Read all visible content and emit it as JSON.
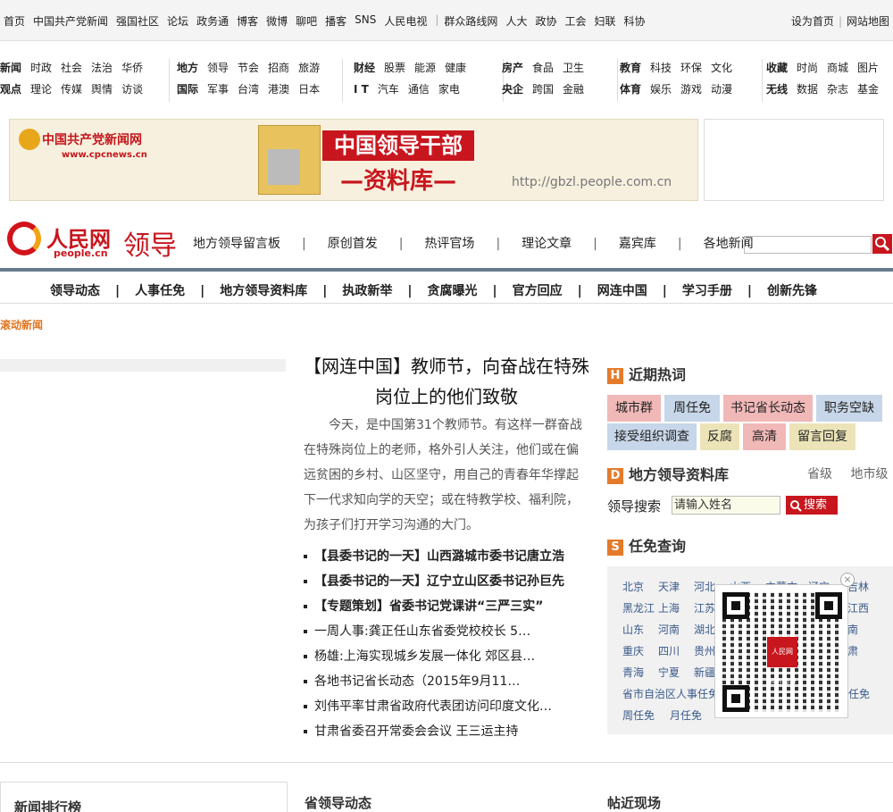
{
  "topbar": {
    "links": [
      "首页",
      "中国共产党新闻",
      "强国社区",
      "论坛",
      "政务通",
      "博客",
      "微博",
      "聊吧",
      "播客",
      "SNS",
      "人民电视",
      "|",
      "群众路线网",
      "人大",
      "政协",
      "工会",
      "妇联",
      "科协"
    ],
    "right_home": "设为首页",
    "right_sep": "|",
    "right_map": "网站地图"
  },
  "channels": [
    {
      "rows": [
        [
          "新闻",
          "时政",
          "社会",
          "法治",
          "华侨"
        ],
        [
          "观点",
          "理论",
          "传媒",
          "舆情",
          "访谈"
        ]
      ]
    },
    {
      "rows": [
        [
          "地方",
          "领导",
          "节会",
          "招商",
          "旅游"
        ],
        [
          "国际",
          "军事",
          "台湾",
          "港澳",
          "日本"
        ]
      ]
    },
    {
      "rows": [
        [
          "财经",
          "股票",
          "能源",
          "健康"
        ],
        [
          "I T",
          "汽车",
          "通信",
          "家电"
        ]
      ]
    },
    {
      "rows": [
        [
          "房产",
          "食品",
          "卫生"
        ],
        [
          "央企",
          "跨国",
          "金融"
        ]
      ]
    },
    {
      "rows": [
        [
          "教育",
          "科技",
          "环保",
          "文化"
        ],
        [
          "体育",
          "娱乐",
          "游戏",
          "动漫"
        ]
      ]
    },
    {
      "rows": [
        [
          "收藏",
          "时尚",
          "商城",
          "图片"
        ],
        [
          "无线",
          "数据",
          "杂志",
          "基金"
        ]
      ]
    }
  ],
  "banner": {
    "party_name": "中国共产党新闻网",
    "party_url": "www.cpcnews.cn",
    "title1": "中国领导干部",
    "title2": "—资料库—",
    "url": "http://gbzl.people.com.cn"
  },
  "logo": {
    "cn": "人民网",
    "en": "people.cn"
  },
  "section_title": "领导",
  "subnav": [
    "地方领导留言板",
    "原创首发",
    "热评官场",
    "理论文章",
    "嘉宾库",
    "各地新闻"
  ],
  "mainnav": [
    "领导动态",
    "人事任免",
    "地方领导资料库",
    "执政新举",
    "贪腐曝光",
    "官方回应",
    "网连中国",
    "学习手册",
    "创新先锋"
  ],
  "nav_sep": "|",
  "rolling_news": "滚动新闻",
  "article": {
    "headline": "【网连中国】教师节，向奋战在特殊岗位上的他们致敬",
    "lead": "今天，是中国第31个教师节。有这样一群奋战在特殊岗位上的老师，格外引人关注，他们或在偏远贫困的乡村、山区坚守，用自己的青春年华撑起下一代求知向学的天空；或在特教学校、福利院，为孩子们打开学习沟通的大门。"
  },
  "news": [
    {
      "text": "【县委书记的一天】山西潞城市委书记唐立浩",
      "bold": true
    },
    {
      "text": "【县委书记的一天】辽宁立山区委书记孙巨先",
      "bold": true
    },
    {
      "text": "【专题策划】省委书记党课讲“三严三实”",
      "bold": true
    },
    {
      "text": "一周人事:龚正任山东省委党校校长 5…",
      "bold": false
    },
    {
      "text": "杨雄:上海实现城乡发展一体化 郊区县…",
      "bold": false
    },
    {
      "text": "各地书记省长动态（2015年9月11…",
      "bold": false
    },
    {
      "text": "刘伟平率甘肃省政府代表团访问印度文化…",
      "bold": false
    },
    {
      "text": "甘肃省委召开常委会会议 王三运主持",
      "bold": false
    }
  ],
  "hot": {
    "icon_letter": "H",
    "title": "近期热词",
    "tags": [
      {
        "label": "城市群",
        "color": "#f1b8b8"
      },
      {
        "label": "周任免",
        "color": "#c7d6e8"
      },
      {
        "label": "书记省长动态",
        "color": "#f1b8b8"
      },
      {
        "label": "职务空缺",
        "color": "#c7d6e8"
      },
      {
        "label": "接受组织调查",
        "color": "#c7d6e8"
      },
      {
        "label": "反腐",
        "color": "#ece4b8"
      },
      {
        "label": "高清",
        "color": "#f1b8b8"
      },
      {
        "label": "留言回复",
        "color": "#ece4b8"
      }
    ]
  },
  "library": {
    "icon_letter": "D",
    "title": "地方领导资料库",
    "tab1": "省级",
    "tab2": "地市级",
    "search_label": "领导搜索",
    "search_placeholder": "请输入姓名",
    "search_button": "搜索"
  },
  "appoint": {
    "icon_letter": "S",
    "title": "任免查询",
    "cities": [
      "北京",
      "天津",
      "河北",
      "山西",
      "内蒙古",
      "辽宁",
      "吉林",
      "黑龙江",
      "上海",
      "江苏",
      "",
      "",
      "",
      "江西",
      "山东",
      "河南",
      "湖北",
      "",
      "",
      "",
      "南",
      "重庆",
      "四川",
      "贵州",
      "",
      "",
      "",
      "肃",
      "青海",
      "宁夏",
      "新疆",
      "",
      "",
      "",
      ""
    ],
    "extra1": "省市自治区人事任免",
    "extra1_tail": "任免",
    "extra2": "周任免",
    "extra3": "月任免"
  },
  "qr": {
    "close": "×",
    "center_label": "人民网 地方领导"
  },
  "bottom": {
    "left": "新闻排行榜",
    "mid": "省领导动态",
    "right": "帖近现场"
  }
}
